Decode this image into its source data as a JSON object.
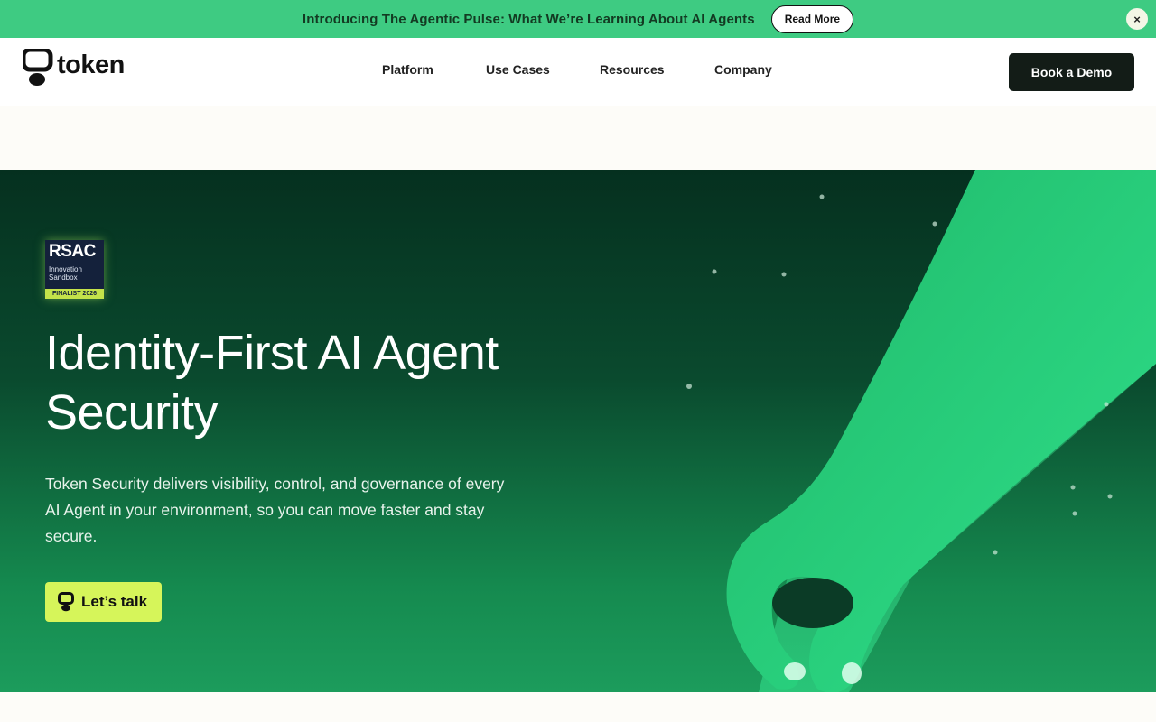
{
  "announcement": {
    "text": "Introducing The Agentic Pulse: What We’re Learning About AI Agents",
    "button_label": "Read More",
    "close_glyph": "×"
  },
  "header": {
    "logo_text": "token",
    "nav": [
      "Platform",
      "Use Cases",
      "Resources",
      "Company"
    ],
    "cta_label": "Book a Demo"
  },
  "hero": {
    "badge": {
      "title": "RSAC",
      "line1": "Innovation",
      "line2": "Sandbox",
      "finalist": "FINALIST 2026"
    },
    "title": "Identity-First AI Agent Security",
    "description": "Token Security delivers visibility, control, and governance of every AI Agent in your environment, so you can move faster and stay secure.",
    "cta_label": "Let’s talk",
    "cta_icon": "token-logo-icon"
  },
  "colors": {
    "announce_bg": "#3ecb82",
    "hero_dark": "#05301f",
    "hero_green": "#1c9c5c",
    "cta_bg": "#d6f55a",
    "demo_bg": "#131c17",
    "arm_green": "#27d37e"
  }
}
